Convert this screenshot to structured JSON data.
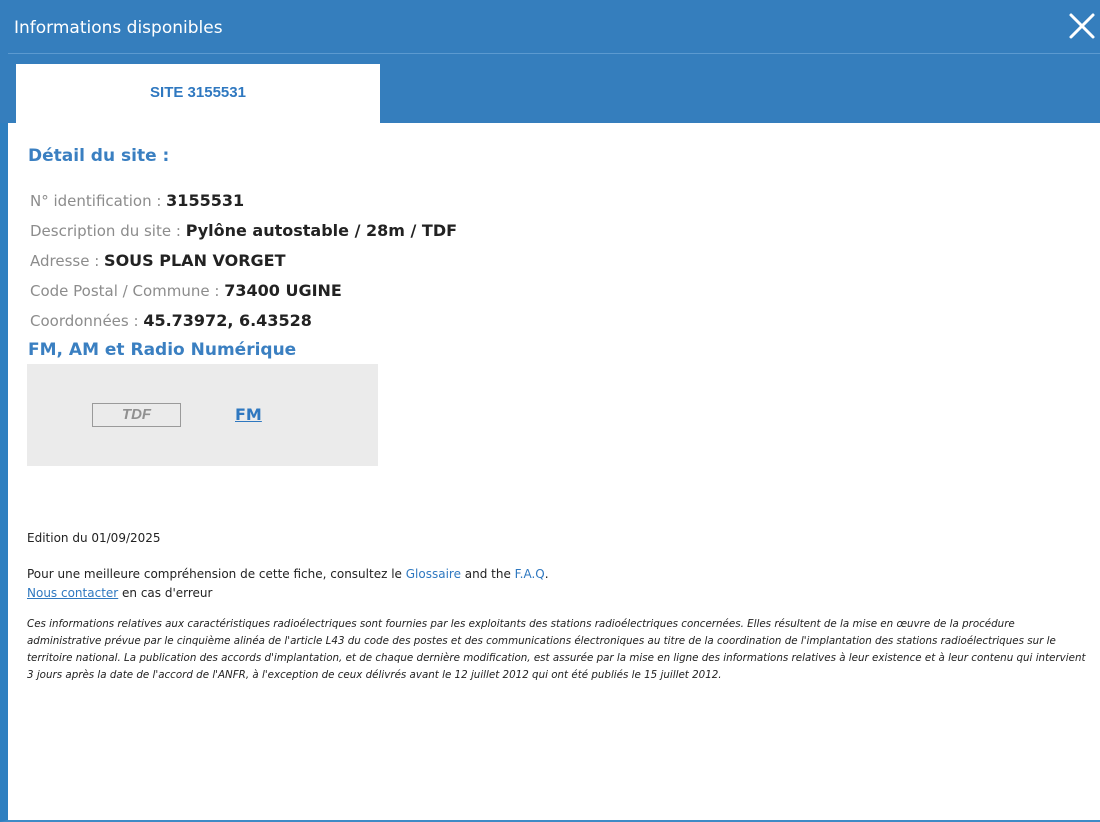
{
  "header": {
    "title": "Informations disponibles",
    "close_icon": "close-icon"
  },
  "tab": {
    "label": "SITE 3155531"
  },
  "detail": {
    "title": "Détail du site :",
    "rows": [
      {
        "label": "N° identification : ",
        "value": "3155531"
      },
      {
        "label": "Description du site : ",
        "value": "Pylône autostable / 28m / TDF"
      },
      {
        "label": "Adresse : ",
        "value": "SOUS PLAN VORGET"
      },
      {
        "label": "Code Postal / Commune : ",
        "value": "73400 UGINE"
      },
      {
        "label": "Coordonnées : ",
        "value": "45.73972, 6.43528"
      }
    ]
  },
  "radio": {
    "title": "FM, AM et Radio Numérique",
    "operator": "TDF",
    "link": "FM"
  },
  "footer": {
    "edition": "Edition du 01/09/2025",
    "help_prefix": "Pour une meilleure compréhension de cette fiche, consultez le ",
    "glossary_link": "Glossaire",
    "help_middle": " and the ",
    "faq_link": "F.A.Q",
    "help_suffix": ".",
    "contact_link": "Nous contacter",
    "contact_suffix": " en cas d'erreur",
    "disclaimer": "Ces informations relatives aux caractéristiques radioélectriques sont fournies par les exploitants des stations radioélectriques concernées. Elles résultent de la mise en œuvre de la procédure administrative prévue par le cinquième alinéa de l'article L43 du code des postes et des communications électroniques au titre de la coordination de l'implantation des stations radioélectriques sur le territoire national. La publication des accords d'implantation, et de chaque dernière modification, est assurée par la mise en ligne des informations relatives à leur existence et à leur contenu qui intervient 3 jours après la date de l'accord de l'ANFR, à l'exception de ceux délivrés avant le 12 juillet 2012 qui ont été publiés le 15 juillet 2012."
  },
  "colors": {
    "header_bg": "#357ebd",
    "accent": "#2f78c0",
    "label_gray": "#8c8c8c",
    "radio_box_bg": "#ebebeb"
  }
}
